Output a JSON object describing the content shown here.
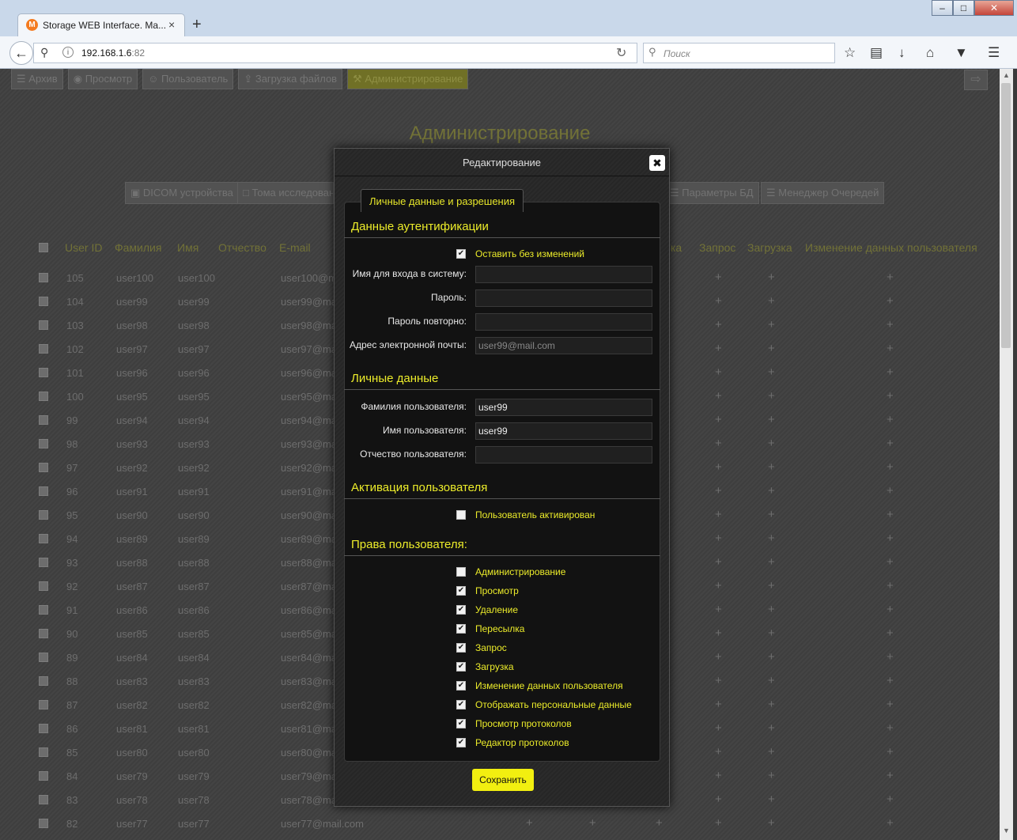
{
  "browser": {
    "tab_title": "Storage WEB Interface. Ma...",
    "tab_close": "×",
    "new_tab": "+",
    "url_host": "192.168.1.6",
    "url_port": ":82",
    "search_placeholder": "Поиск",
    "window_buttons": {
      "minimize": "–",
      "maximize": "□",
      "close": "✕"
    }
  },
  "nav": {
    "items": [
      {
        "label": "Архив",
        "icon": "list-icon"
      },
      {
        "label": "Просмотр",
        "icon": "eye-icon"
      },
      {
        "label": "Пользователь",
        "icon": "user-icon"
      },
      {
        "label": "Загрузка файлов",
        "icon": "upload-icon"
      },
      {
        "label": "Администрирование",
        "icon": "tools-icon",
        "active": true
      }
    ]
  },
  "page_title": "Администрирование",
  "admin_buttons": [
    {
      "label": "DICOM устройства",
      "icon": "devices-icon"
    },
    {
      "label": "Тома исследован",
      "icon": "folder-icon"
    },
    {
      "label": "Параметры БД",
      "icon": "database-icon"
    },
    {
      "label": "Менеджер Очередей",
      "icon": "layers-icon"
    }
  ],
  "table": {
    "columns": [
      "User ID",
      "Фамилия",
      "Имя",
      "Отчество",
      "E-mail",
      "ка",
      "Запрос",
      "Загрузка",
      "Изменение данных пользователя"
    ],
    "rows": [
      {
        "id": "105",
        "last": "user100",
        "first": "user100",
        "email": "user100@mai"
      },
      {
        "id": "104",
        "last": "user99",
        "first": "user99",
        "email": "user99@mai"
      },
      {
        "id": "103",
        "last": "user98",
        "first": "user98",
        "email": "user98@mai"
      },
      {
        "id": "102",
        "last": "user97",
        "first": "user97",
        "email": "user97@mai"
      },
      {
        "id": "101",
        "last": "user96",
        "first": "user96",
        "email": "user96@mai"
      },
      {
        "id": "100",
        "last": "user95",
        "first": "user95",
        "email": "user95@mai"
      },
      {
        "id": "99",
        "last": "user94",
        "first": "user94",
        "email": "user94@mai"
      },
      {
        "id": "98",
        "last": "user93",
        "first": "user93",
        "email": "user93@mai"
      },
      {
        "id": "97",
        "last": "user92",
        "first": "user92",
        "email": "user92@mai"
      },
      {
        "id": "96",
        "last": "user91",
        "first": "user91",
        "email": "user91@mai"
      },
      {
        "id": "95",
        "last": "user90",
        "first": "user90",
        "email": "user90@mai"
      },
      {
        "id": "94",
        "last": "user89",
        "first": "user89",
        "email": "user89@mai"
      },
      {
        "id": "93",
        "last": "user88",
        "first": "user88",
        "email": "user88@mai"
      },
      {
        "id": "92",
        "last": "user87",
        "first": "user87",
        "email": "user87@mai"
      },
      {
        "id": "91",
        "last": "user86",
        "first": "user86",
        "email": "user86@mai"
      },
      {
        "id": "90",
        "last": "user85",
        "first": "user85",
        "email": "user85@mai"
      },
      {
        "id": "89",
        "last": "user84",
        "first": "user84",
        "email": "user84@mai"
      },
      {
        "id": "88",
        "last": "user83",
        "first": "user83",
        "email": "user83@mai"
      },
      {
        "id": "87",
        "last": "user82",
        "first": "user82",
        "email": "user82@mai"
      },
      {
        "id": "86",
        "last": "user81",
        "first": "user81",
        "email": "user81@mai"
      },
      {
        "id": "85",
        "last": "user80",
        "first": "user80",
        "email": "user80@mai"
      },
      {
        "id": "84",
        "last": "user79",
        "first": "user79",
        "email": "user79@mai"
      },
      {
        "id": "83",
        "last": "user78",
        "first": "user78",
        "email": "user78@mai"
      },
      {
        "id": "82",
        "last": "user77",
        "first": "user77",
        "email": "user77@mail.com"
      }
    ],
    "plus_glyph": "+"
  },
  "modal": {
    "title": "Редактирование",
    "close_glyph": "✖",
    "tab_label": "Личные данные и разрешения",
    "auth": {
      "title": "Данные аутентификации",
      "keep_unchanged_label": "Оставить без изменений",
      "keep_unchanged_checked": true,
      "login_label": "Имя для входа в систему:",
      "login_value": "",
      "password_label": "Пароль:",
      "password_value": "",
      "password_repeat_label": "Пароль повторно:",
      "password_repeat_value": "",
      "email_label": "Адрес электронной почты:",
      "email_value": "user99@mail.com"
    },
    "personal": {
      "title": "Личные данные",
      "last_name_label": "Фамилия пользователя:",
      "last_name_value": "user99",
      "first_name_label": "Имя пользователя:",
      "first_name_value": "user99",
      "middle_name_label": "Отчество пользователя:",
      "middle_name_value": ""
    },
    "activation": {
      "title": "Активация пользователя",
      "activated_label": "Пользователь активирован",
      "activated_checked": false
    },
    "rights": {
      "title": "Права пользователя:",
      "items": [
        {
          "label": "Администрирование",
          "checked": false
        },
        {
          "label": "Просмотр",
          "checked": true
        },
        {
          "label": "Удаление",
          "checked": true
        },
        {
          "label": "Пересылка",
          "checked": true
        },
        {
          "label": "Запрос",
          "checked": true
        },
        {
          "label": "Загрузка",
          "checked": true
        },
        {
          "label": "Изменение данных пользователя",
          "checked": true
        },
        {
          "label": "Отображать персональные данные",
          "checked": true
        },
        {
          "label": "Просмотр протоколов",
          "checked": true
        },
        {
          "label": "Редактор протоколов",
          "checked": true
        }
      ]
    },
    "save_label": "Сохранить"
  },
  "colors": {
    "accent": "#ecec2a",
    "save_button": "#f2ef10"
  }
}
